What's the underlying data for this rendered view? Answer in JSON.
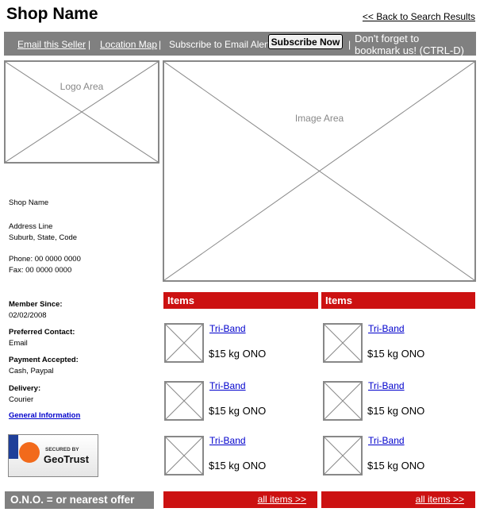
{
  "header": {
    "shop_name": "Shop Name",
    "back_link": "<< Back to Search Results"
  },
  "toolbar": {
    "email_seller": "Email this Seller",
    "sep1": "|",
    "location_map": "Location Map",
    "sep2": "|",
    "subscribe_text": "Subscribe to Email Alerts",
    "subscribe_button": "Subscribe Now",
    "sep3": "|",
    "bookmark_line1": "Don't forget to",
    "bookmark_line2": "bookmark us! (CTRL-D)"
  },
  "logo_area": {
    "label": "Logo Area"
  },
  "image_area": {
    "label": "Image Area"
  },
  "shop_info": {
    "name": "Shop Name",
    "address_line": "Address Line",
    "suburb_line": "Suburb, State, Code",
    "phone": "Phone: 00 0000 0000",
    "fax": "Fax: 00 0000 0000"
  },
  "member": {
    "since_label": "Member Since:",
    "since_value": "02/02/2008",
    "contact_label": "Preferred Contact:",
    "contact_value": "Email",
    "payment_label": "Payment Accepted:",
    "payment_value": "Cash, Paypal",
    "delivery_label": "Delivery:",
    "delivery_value": "Courier",
    "general_info_link": "General Information"
  },
  "geotrust": {
    "line1": "SECURED BY",
    "line2": "GeoTrust"
  },
  "footer_note": "O.N.O. = or nearest offer",
  "columns": [
    {
      "header": "Items",
      "items": [
        {
          "name": "Tri-Band",
          "price": "$15 kg ONO"
        },
        {
          "name": "Tri-Band",
          "price": "$15 kg ONO"
        },
        {
          "name": "Tri-Band",
          "price": "$15 kg ONO"
        }
      ],
      "all_items": "all items >>"
    },
    {
      "header": "Items",
      "items": [
        {
          "name": "Tri-Band",
          "price": "$15 kg ONO"
        },
        {
          "name": "Tri-Band",
          "price": "$15 kg ONO"
        },
        {
          "name": "Tri-Band",
          "price": "$15 kg ONO"
        }
      ],
      "all_items": "all items >>"
    }
  ]
}
